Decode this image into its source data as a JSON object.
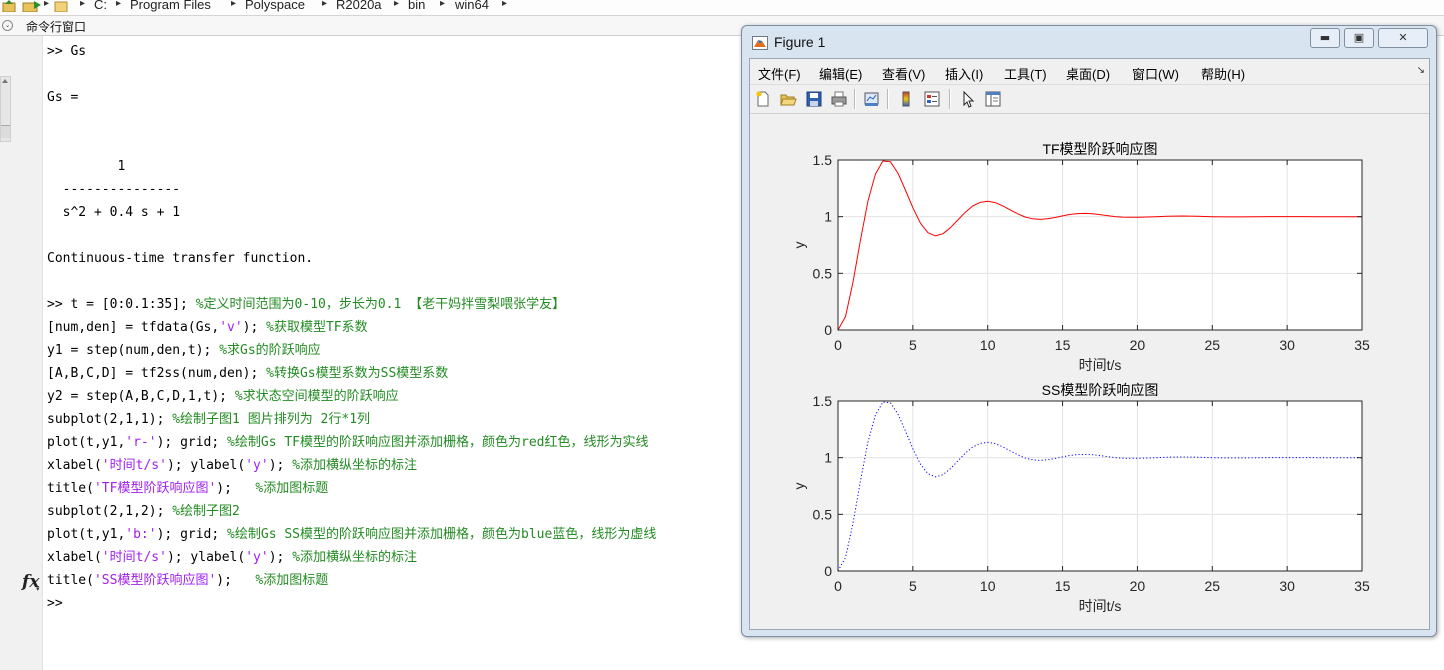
{
  "path_bar": {
    "segments": [
      "C:",
      "Program Files",
      "Polyspace",
      "R2020a",
      "bin",
      "win64"
    ]
  },
  "command_window": {
    "title": "命令行窗口",
    "lines": [
      [
        {
          "t": ">> Gs",
          "c": "n"
        }
      ],
      [],
      [
        {
          "t": "Gs =",
          "c": "n"
        }
      ],
      [],
      [],
      [
        {
          "t": "         1",
          "c": "n"
        }
      ],
      [
        {
          "t": "  ---------------",
          "c": "n"
        }
      ],
      [
        {
          "t": "  s^2 + 0.4 s + 1",
          "c": "n"
        }
      ],
      [],
      [
        {
          "t": "Continuous-time transfer function.",
          "c": "n"
        }
      ],
      [],
      [
        {
          "t": ">> t = [0:0.1:35]; ",
          "c": "n"
        },
        {
          "t": "%定义时间范围为0-10，步长为0.1 【老干妈拌雪梨喂张学友】",
          "c": "cm"
        }
      ],
      [
        {
          "t": "[num,den] = tfdata(Gs,",
          "c": "n"
        },
        {
          "t": "'v'",
          "c": "st"
        },
        {
          "t": "); ",
          "c": "n"
        },
        {
          "t": "%获取模型TF系数",
          "c": "cm"
        }
      ],
      [
        {
          "t": "y1 = step(num,den,t); ",
          "c": "n"
        },
        {
          "t": "%求Gs的阶跃响应",
          "c": "cm"
        }
      ],
      [
        {
          "t": "[A,B,C,D] = tf2ss(num,den); ",
          "c": "n"
        },
        {
          "t": "%转换Gs模型系数为SS模型系数",
          "c": "cm"
        }
      ],
      [
        {
          "t": "y2 = step(A,B,C,D,1,t); ",
          "c": "n"
        },
        {
          "t": "%求状态空间模型的阶跃响应",
          "c": "cm"
        }
      ],
      [
        {
          "t": "subplot(2,1,1); ",
          "c": "n"
        },
        {
          "t": "%绘制子图1 图片排列为 2行*1列",
          "c": "cm"
        }
      ],
      [
        {
          "t": "plot(t,y1,",
          "c": "n"
        },
        {
          "t": "'r-'",
          "c": "st"
        },
        {
          "t": "); grid; ",
          "c": "n"
        },
        {
          "t": "%绘制Gs TF模型的阶跃响应图并添加栅格，颜色为red红色，线形为实线",
          "c": "cm"
        }
      ],
      [
        {
          "t": "xlabel(",
          "c": "n"
        },
        {
          "t": "'时间t/s'",
          "c": "st"
        },
        {
          "t": "); ylabel(",
          "c": "n"
        },
        {
          "t": "'y'",
          "c": "st"
        },
        {
          "t": "); ",
          "c": "n"
        },
        {
          "t": "%添加横纵坐标的标注",
          "c": "cm"
        }
      ],
      [
        {
          "t": "title(",
          "c": "n"
        },
        {
          "t": "'TF模型阶跃响应图'",
          "c": "st"
        },
        {
          "t": ");   ",
          "c": "n"
        },
        {
          "t": "%添加图标题",
          "c": "cm"
        }
      ],
      [
        {
          "t": "subplot(2,1,2); ",
          "c": "n"
        },
        {
          "t": "%绘制子图2",
          "c": "cm"
        }
      ],
      [
        {
          "t": "plot(t,y1,",
          "c": "n"
        },
        {
          "t": "'b:'",
          "c": "st"
        },
        {
          "t": "); grid; ",
          "c": "n"
        },
        {
          "t": "%绘制Gs SS模型的阶跃响应图并添加栅格，颜色为blue蓝色，线形为虚线",
          "c": "cm"
        }
      ],
      [
        {
          "t": "xlabel(",
          "c": "n"
        },
        {
          "t": "'时间t/s'",
          "c": "st"
        },
        {
          "t": "); ylabel(",
          "c": "n"
        },
        {
          "t": "'y'",
          "c": "st"
        },
        {
          "t": "); ",
          "c": "n"
        },
        {
          "t": "%添加横纵坐标的标注",
          "c": "cm"
        }
      ],
      [
        {
          "t": "title(",
          "c": "n"
        },
        {
          "t": "'SS模型阶跃响应图'",
          "c": "st"
        },
        {
          "t": ");   ",
          "c": "n"
        },
        {
          "t": "%添加图标题",
          "c": "cm"
        }
      ],
      [
        {
          "t": ">>",
          "c": "n"
        }
      ]
    ],
    "prompt_icon": "fx"
  },
  "figure": {
    "title": "Figure 1",
    "menu": [
      "文件(F)",
      "编辑(E)",
      "查看(V)",
      "插入(I)",
      "工具(T)",
      "桌面(D)",
      "窗口(W)",
      "帮助(H)"
    ],
    "toolbar": [
      "new-figure-icon",
      "open-file-icon",
      "save-icon",
      "print-icon",
      "link-plot-icon",
      "colorbar-icon",
      "legend-icon",
      "edit-plot-icon",
      "property-inspector-icon"
    ],
    "window_buttons": [
      "minimize",
      "maximize",
      "close"
    ]
  },
  "chart_data": [
    {
      "type": "line",
      "title": "TF模型阶跃响应图",
      "xlabel": "时间t/s",
      "ylabel": "y",
      "xlim": [
        0,
        35
      ],
      "ylim": [
        0,
        1.5
      ],
      "xticks": [
        0,
        5,
        10,
        15,
        20,
        25,
        30,
        35
      ],
      "yticks": [
        0,
        0.5,
        1,
        1.5
      ],
      "grid": true,
      "line_color": "#ff0000",
      "line_style": "solid",
      "series": [
        {
          "x": [
            0,
            0.5,
            1,
            1.5,
            2,
            2.5,
            3,
            3.5,
            4,
            4.5,
            5,
            5.5,
            6,
            6.5,
            7,
            7.5,
            8,
            8.5,
            9,
            9.5,
            10,
            10.5,
            11,
            11.5,
            12,
            12.5,
            13,
            13.5,
            14,
            14.5,
            15,
            15.5,
            16,
            16.5,
            17,
            17.5,
            18,
            18.5,
            19,
            19.5,
            20,
            21,
            22,
            23,
            24,
            25,
            26,
            27,
            28,
            29,
            30,
            31,
            32,
            33,
            34,
            35
          ],
          "y": [
            0,
            0.118,
            0.423,
            0.795,
            1.136,
            1.376,
            1.491,
            1.484,
            1.385,
            1.235,
            1.078,
            0.945,
            0.859,
            0.83,
            0.849,
            0.902,
            0.971,
            1.039,
            1.094,
            1.126,
            1.136,
            1.124,
            1.096,
            1.06,
            1.025,
            0.997,
            0.981,
            0.976,
            0.981,
            0.993,
            1.007,
            1.02,
            1.027,
            1.029,
            1.026,
            1.018,
            1.009,
            1.001,
            0.996,
            0.994,
            0.994,
            0.998,
            1.004,
            1.006,
            1.004,
            1.0,
            0.998,
            0.998,
            0.999,
            1.001,
            1.001,
            1.001,
            1.0,
            1.0,
            1.0,
            1.0
          ]
        }
      ]
    },
    {
      "type": "line",
      "title": "SS模型阶跃响应图",
      "xlabel": "时间t/s",
      "ylabel": "y",
      "xlim": [
        0,
        35
      ],
      "ylim": [
        0,
        1.5
      ],
      "xticks": [
        0,
        5,
        10,
        15,
        20,
        25,
        30,
        35
      ],
      "yticks": [
        0,
        0.5,
        1,
        1.5
      ],
      "grid": true,
      "line_color": "#0000ff",
      "line_style": "dotted",
      "series": [
        {
          "x": [
            0,
            0.5,
            1,
            1.5,
            2,
            2.5,
            3,
            3.5,
            4,
            4.5,
            5,
            5.5,
            6,
            6.5,
            7,
            7.5,
            8,
            8.5,
            9,
            9.5,
            10,
            10.5,
            11,
            11.5,
            12,
            12.5,
            13,
            13.5,
            14,
            14.5,
            15,
            15.5,
            16,
            16.5,
            17,
            17.5,
            18,
            18.5,
            19,
            19.5,
            20,
            21,
            22,
            23,
            24,
            25,
            26,
            27,
            28,
            29,
            30,
            31,
            32,
            33,
            34,
            35
          ],
          "y": [
            0,
            0.118,
            0.423,
            0.795,
            1.136,
            1.376,
            1.491,
            1.484,
            1.385,
            1.235,
            1.078,
            0.945,
            0.859,
            0.83,
            0.849,
            0.902,
            0.971,
            1.039,
            1.094,
            1.126,
            1.136,
            1.124,
            1.096,
            1.06,
            1.025,
            0.997,
            0.981,
            0.976,
            0.981,
            0.993,
            1.007,
            1.02,
            1.027,
            1.029,
            1.026,
            1.018,
            1.009,
            1.001,
            0.996,
            0.994,
            0.994,
            0.998,
            1.004,
            1.006,
            1.004,
            1.0,
            0.998,
            0.998,
            0.999,
            1.001,
            1.001,
            1.001,
            1.0,
            1.0,
            1.0,
            1.0
          ]
        }
      ]
    }
  ]
}
